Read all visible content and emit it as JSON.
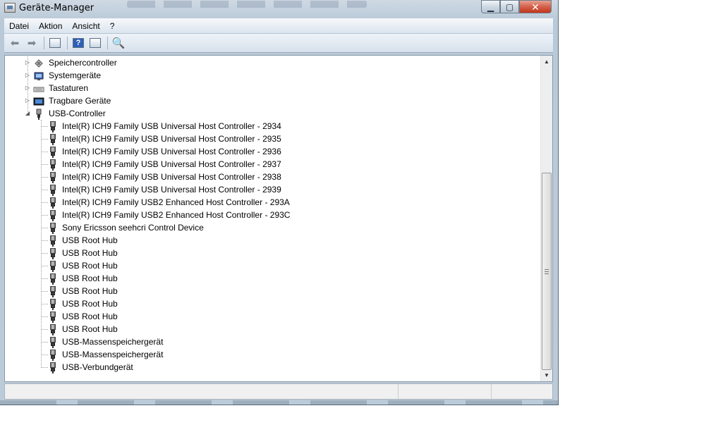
{
  "window": {
    "title": "Geräte-Manager",
    "caption_buttons": [
      "minimize",
      "maximize",
      "close"
    ]
  },
  "menu": [
    "Datei",
    "Aktion",
    "Ansicht",
    "?"
  ],
  "toolbar": {
    "buttons": [
      "back-icon",
      "forward-icon",
      "properties-icon",
      "help-icon",
      "show-hidden-icon",
      "scan-hardware-icon"
    ]
  },
  "tree": {
    "categories": [
      {
        "label": "Speichercontroller",
        "expanded": false,
        "icon": "storage-controller-icon"
      },
      {
        "label": "Systemgeräte",
        "expanded": false,
        "icon": "system-devices-icon"
      },
      {
        "label": "Tastaturen",
        "expanded": false,
        "icon": "keyboard-icon"
      },
      {
        "label": "Tragbare Geräte",
        "expanded": false,
        "icon": "portable-devices-icon"
      },
      {
        "label": "USB-Controller",
        "expanded": true,
        "icon": "usb-icon"
      }
    ],
    "usb_children": [
      "Intel(R) ICH9 Family USB Universal Host Controller - 2934",
      "Intel(R) ICH9 Family USB Universal Host Controller - 2935",
      "Intel(R) ICH9 Family USB Universal Host Controller - 2936",
      "Intel(R) ICH9 Family USB Universal Host Controller - 2937",
      "Intel(R) ICH9 Family USB Universal Host Controller - 2938",
      "Intel(R) ICH9 Family USB Universal Host Controller - 2939",
      "Intel(R) ICH9 Family USB2 Enhanced Host Controller - 293A",
      "Intel(R) ICH9 Family USB2 Enhanced Host Controller - 293C",
      "Sony Ericsson seehcri Control Device",
      "USB Root Hub",
      "USB Root Hub",
      "USB Root Hub",
      "USB Root Hub",
      "USB Root Hub",
      "USB Root Hub",
      "USB Root Hub",
      "USB Root Hub",
      "USB-Massenspeichergerät",
      "USB-Massenspeichergerät",
      "USB-Verbundgerät"
    ]
  },
  "scrollbar": {
    "position_fraction": 0.62
  }
}
